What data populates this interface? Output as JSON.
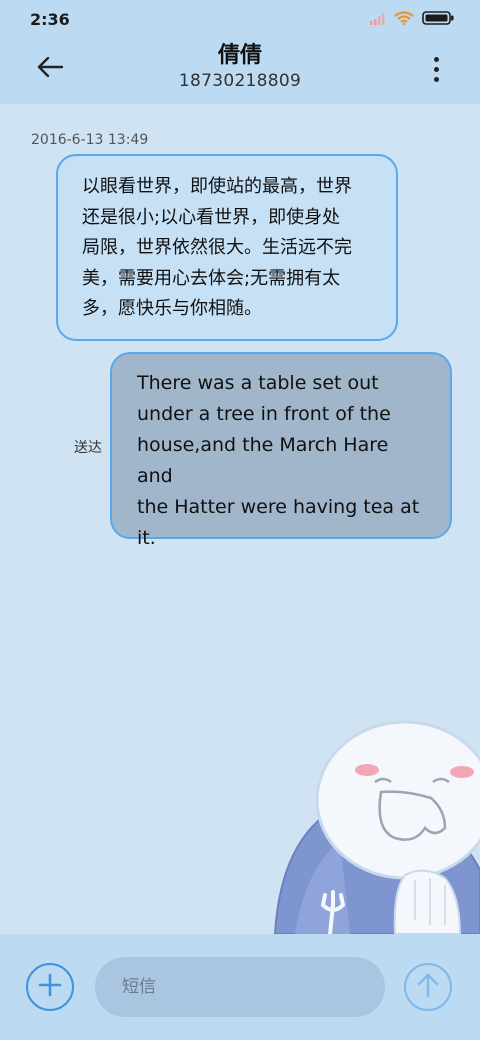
{
  "status_bar": {
    "time": "2:36",
    "icons": [
      "signal-icon",
      "wifi-icon",
      "battery-icon"
    ]
  },
  "header": {
    "contact_name": "倩倩",
    "phone_number": "18730218809",
    "back_icon": "arrow-left-icon",
    "more_icon": "more-vertical-icon"
  },
  "conversation": {
    "timestamp": "2016-6-13 13:49",
    "messages": [
      {
        "direction": "incoming",
        "lines": [
          "以眼看世界，即使站的最高，世界",
          "还是很小;以心看世界，即使身处",
          "局限，世界依然很大。生活远不完",
          "美，需要用心去体会;无需拥有太",
          "多，愿快乐与你相随。"
        ]
      },
      {
        "direction": "outgoing",
        "status": "送达",
        "lines": [
          "There was a table set out",
          "under a tree in front of the",
          "house,and the March Hare and",
          "the Hatter were having tea at",
          "it."
        ]
      }
    ]
  },
  "composer": {
    "placeholder": "短信",
    "value": "",
    "add_icon": "plus-icon",
    "send_icon": "arrow-up-icon"
  },
  "colors": {
    "background": "#cfe3f3",
    "bar": "#bcdaf2",
    "accent": "#3e92e0",
    "incoming_bubble": "#c6e0f6",
    "outgoing_bubble": "#a1b5cb"
  }
}
